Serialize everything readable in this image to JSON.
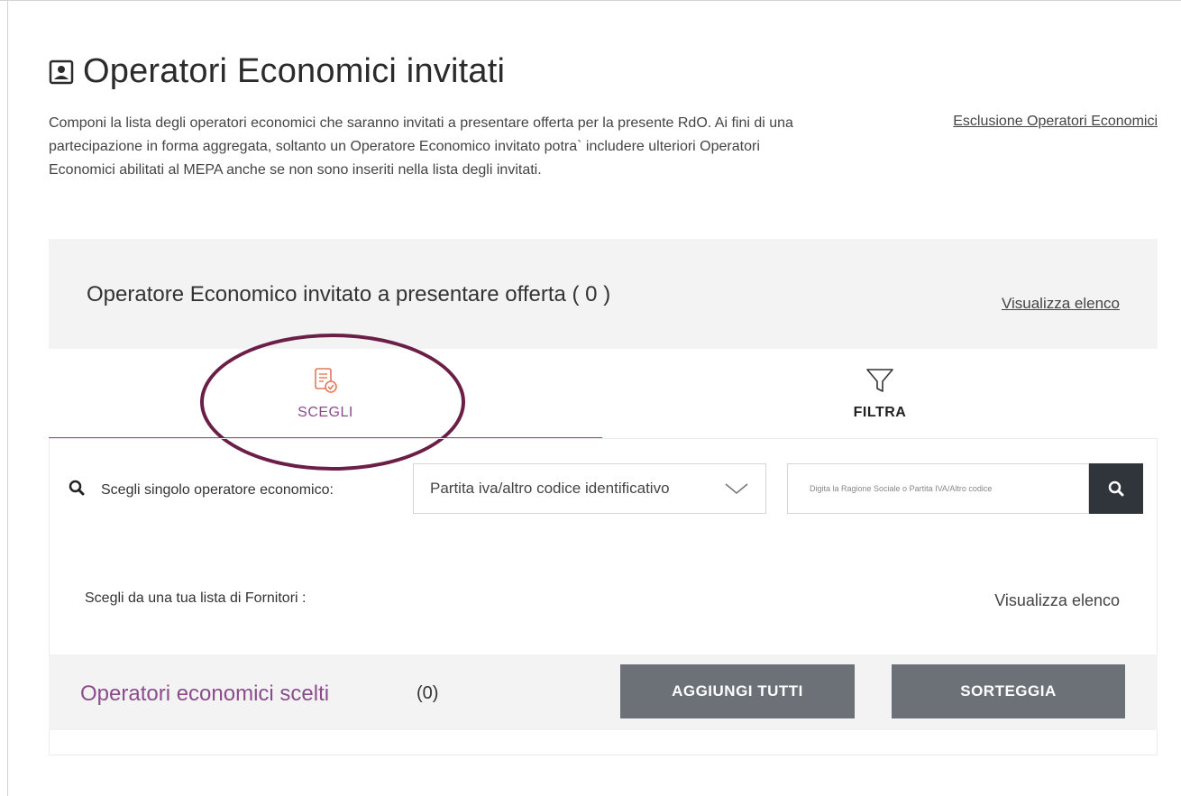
{
  "page": {
    "title": "Operatori Economici invitati",
    "intro": "Componi la lista degli operatori economici che saranno invitati a presentare offerta per la presente RdO. Ai fini di una partecipazione in forma aggregata, soltanto un Operatore Economico invitato potra` includere ulteriori Operatori Economici abilitati al MEPA anche se non sono inseriti nella lista degli invitati.",
    "exclusion_link": "Esclusione Operatori Economici"
  },
  "invited_panel": {
    "title": "Operatore Economico invitato a presentare offerta ( 0 )",
    "view_link": "Visualizza elenco"
  },
  "tabs": [
    {
      "label": "SCEGLI",
      "icon": "document-check-icon",
      "active": true
    },
    {
      "label": "FILTRA",
      "icon": "funnel-icon",
      "active": false
    }
  ],
  "single_search": {
    "label": "Scegli singolo operatore economico:",
    "select_value": "Partita iva/altro codice identificativo",
    "placeholder": "Digita la Ragione Sociale o Partita IVA/Altro codice"
  },
  "supplier_list": {
    "label": "Scegli da una tua lista di Fornitori :",
    "view_link": "Visualizza elenco"
  },
  "chosen": {
    "label": "Operatori economici scelti",
    "count": "(0)",
    "add_all_button": "AGGIUNGI TUTTI",
    "draw_button": "SORTEGGIA"
  },
  "colors": {
    "accent": "#8b4c8c",
    "icon_orange": "#e07a5a",
    "button_gray": "#6b7177",
    "search_button": "#2f353a",
    "annotation": "#6b1f47"
  }
}
